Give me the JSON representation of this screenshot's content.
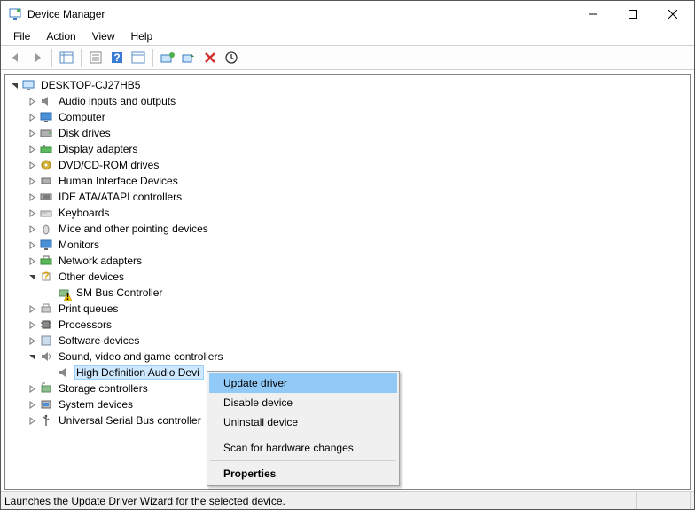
{
  "window": {
    "title": "Device Manager"
  },
  "menu": {
    "items": [
      "File",
      "Action",
      "View",
      "Help"
    ]
  },
  "tree": {
    "root": "DESKTOP-CJ27HB5",
    "categories": [
      {
        "label": "Audio inputs and outputs",
        "expanded": false
      },
      {
        "label": "Computer",
        "expanded": false
      },
      {
        "label": "Disk drives",
        "expanded": false
      },
      {
        "label": "Display adapters",
        "expanded": false
      },
      {
        "label": "DVD/CD-ROM drives",
        "expanded": false
      },
      {
        "label": "Human Interface Devices",
        "expanded": false
      },
      {
        "label": "IDE ATA/ATAPI controllers",
        "expanded": false
      },
      {
        "label": "Keyboards",
        "expanded": false
      },
      {
        "label": "Mice and other pointing devices",
        "expanded": false
      },
      {
        "label": "Monitors",
        "expanded": false
      },
      {
        "label": "Network adapters",
        "expanded": false
      },
      {
        "label": "Other devices",
        "expanded": true,
        "children": [
          {
            "label": "SM Bus Controller",
            "warning": true
          }
        ]
      },
      {
        "label": "Print queues",
        "expanded": false
      },
      {
        "label": "Processors",
        "expanded": false
      },
      {
        "label": "Software devices",
        "expanded": false
      },
      {
        "label": "Sound, video and game controllers",
        "expanded": true,
        "children": [
          {
            "label": "High Definition Audio Devi",
            "selected": true
          }
        ]
      },
      {
        "label": "Storage controllers",
        "expanded": false
      },
      {
        "label": "System devices",
        "expanded": false
      },
      {
        "label": "Universal Serial Bus controller",
        "expanded": false
      }
    ]
  },
  "context_menu": {
    "items": [
      {
        "label": "Update driver",
        "highlight": true
      },
      {
        "label": "Disable device"
      },
      {
        "label": "Uninstall device"
      },
      {
        "sep": true
      },
      {
        "label": "Scan for hardware changes"
      },
      {
        "sep": true
      },
      {
        "label": "Properties",
        "bold": true
      }
    ]
  },
  "statusbar": {
    "text": "Launches the Update Driver Wizard for the selected device."
  }
}
